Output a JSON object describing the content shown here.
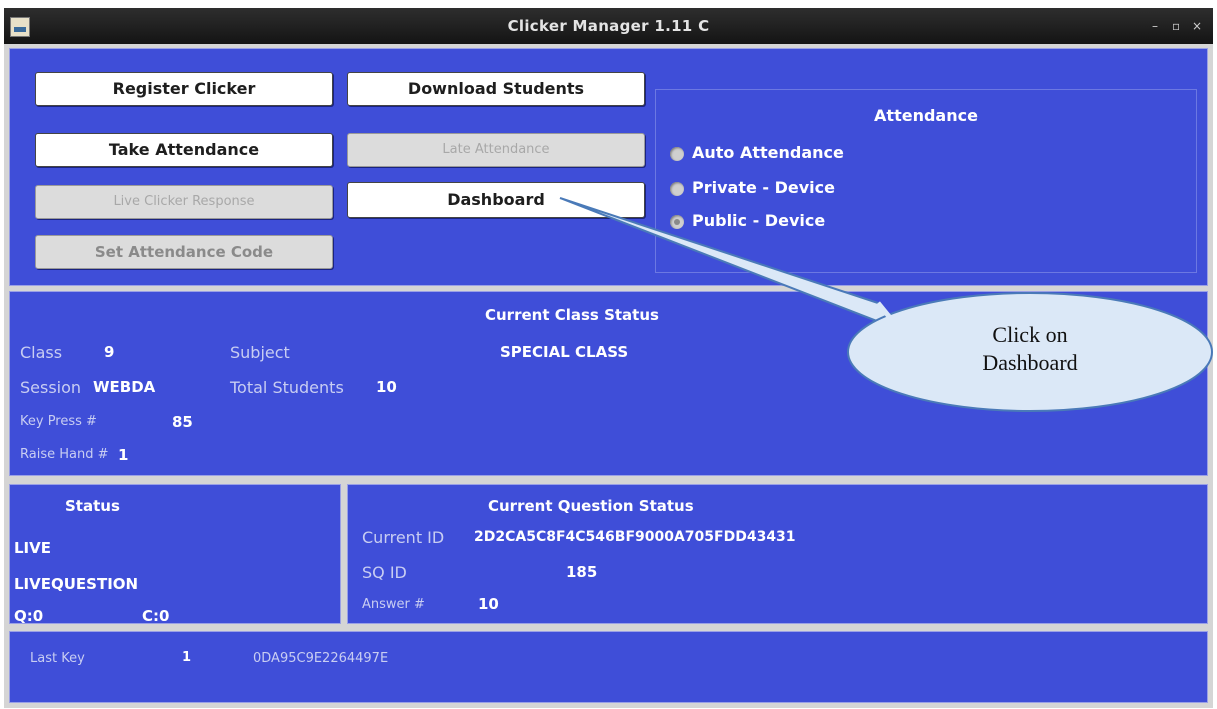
{
  "window": {
    "title": "Clicker Manager 1.11 C",
    "controls": {
      "minimize": "–",
      "maximize": "▫",
      "close": "×"
    }
  },
  "buttons": {
    "register_clicker": "Register Clicker",
    "download_students": "Download Students",
    "take_attendance": "Take Attendance",
    "late_attendance": "Late Attendance",
    "live_clicker_response": "Live Clicker Response",
    "dashboard": "Dashboard",
    "set_attendance_code": "Set Attendance Code"
  },
  "attendance": {
    "title": "Attendance",
    "options": [
      "Auto Attendance",
      "Private - Device",
      "Public - Device"
    ],
    "selected": "Public - Device"
  },
  "class_status": {
    "title": "Current Class Status",
    "class_label": "Class",
    "class_value": "9",
    "subject_label": "Subject",
    "subject_value": "SPECIAL CLASS",
    "session_label": "Session",
    "session_value": "WEBDA",
    "total_label": "Total Students",
    "total_value": "10",
    "keypress_label": "Key Press #",
    "keypress_value": "85",
    "raisehand_label": "Raise Hand #",
    "raisehand_value": "1"
  },
  "status": {
    "title": "Status",
    "line1": "LIVE",
    "line2": "LIVEQUESTION",
    "q": "Q:0",
    "c": "C:0"
  },
  "question_status": {
    "title": "Current Question Status",
    "current_id_label": "Current ID",
    "current_id_value": "2D2CA5C8F4C546BF9000A705FDD43431",
    "sq_id_label": "SQ ID",
    "sq_id_value": "185",
    "answer_label": "Answer #",
    "answer_value": "10"
  },
  "last_key": {
    "label": "Last Key",
    "value": "1",
    "device": "0DA95C9E2264497E"
  },
  "callout": {
    "line1": "Click on",
    "line2": "Dashboard"
  },
  "colors": {
    "panel": "#3f4ed8",
    "titlebar": "#1e1e1e"
  }
}
